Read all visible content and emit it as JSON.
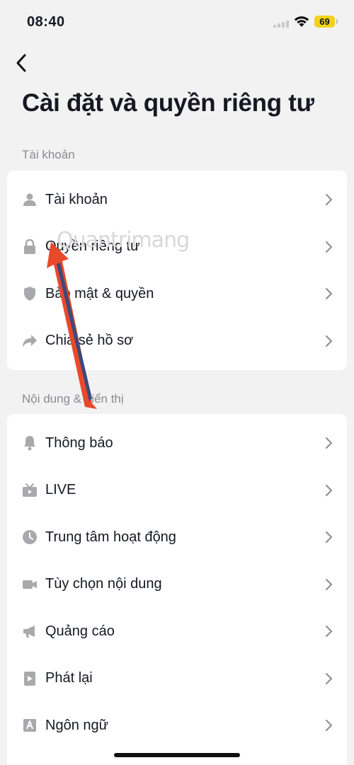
{
  "status_bar": {
    "time": "08:40",
    "battery": "69"
  },
  "page_title": "Cài đặt và quyền riêng tư",
  "watermark": "Quantrimang",
  "sections": [
    {
      "label": "Tài khoản",
      "items": [
        {
          "label": "Tài khoản",
          "icon": "person-icon"
        },
        {
          "label": "Quyền riêng tư",
          "icon": "lock-icon"
        },
        {
          "label": "Bảo mật & quyền",
          "icon": "shield-icon"
        },
        {
          "label": "Chia sẻ hồ sơ",
          "icon": "share-icon"
        }
      ]
    },
    {
      "label": "Nội dung & hiển thị",
      "items": [
        {
          "label": "Thông báo",
          "icon": "bell-icon"
        },
        {
          "label": "LIVE",
          "icon": "tv-icon"
        },
        {
          "label": "Trung tâm hoạt động",
          "icon": "clock-icon"
        },
        {
          "label": "Tùy chọn nội dung",
          "icon": "video-camera-icon"
        },
        {
          "label": "Quảng cáo",
          "icon": "megaphone-icon"
        },
        {
          "label": "Phát lại",
          "icon": "play-icon"
        },
        {
          "label": "Ngôn ngữ",
          "icon": "language-icon"
        }
      ]
    }
  ],
  "colors": {
    "icon_gray": "#a8a9ad",
    "chevron": "#8a8b91",
    "annotation_arrow": "#e8492b",
    "annotation_arrow_inner": "#3d4a7a"
  }
}
